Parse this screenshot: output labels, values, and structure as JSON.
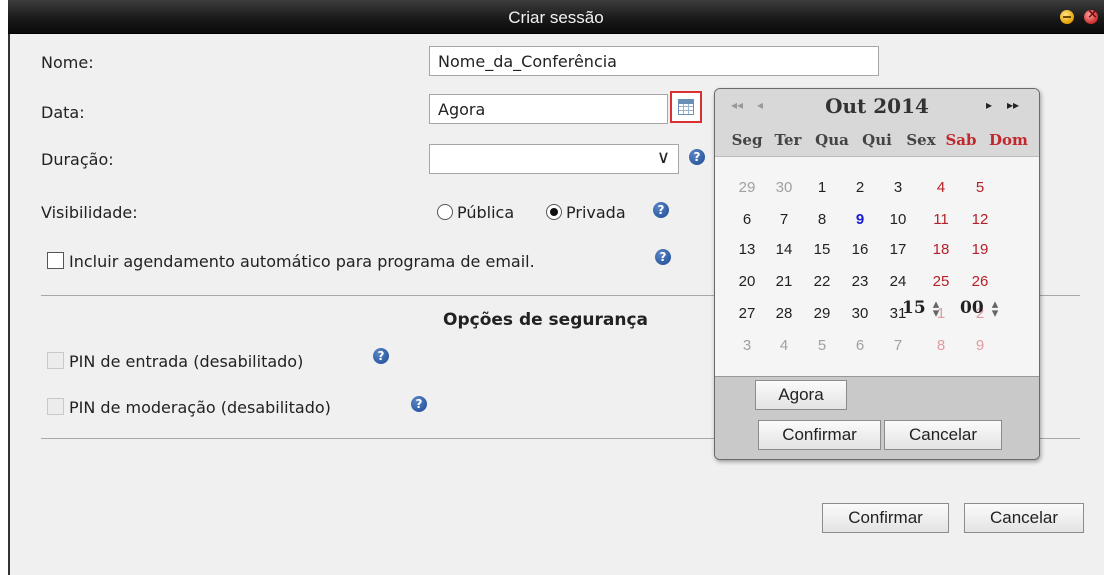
{
  "window": {
    "title": "Criar sessão"
  },
  "form": {
    "name_label": "Nome:",
    "name_value": "Nome_da_Conferência",
    "date_label": "Data:",
    "date_value": "Agora",
    "duration_label": "Duração:",
    "duration_value": "",
    "visibility_label": "Visibilidade:",
    "visibility_options": [
      "Pública",
      "Privada"
    ],
    "visibility_selected": "Privada",
    "auto_schedule_label": "Incluir agendamento automático para programa de email.",
    "security_title": "Opções de segurança",
    "pin_entry_label": "PIN de entrada (desabilitado)",
    "pin_moderation_label": "PIN de moderação (desabilitado)",
    "confirm_label": "Confirmar",
    "cancel_label": "Cancelar"
  },
  "calendar": {
    "month_label": "Out 2014",
    "nav_prev_year": "◂◂",
    "nav_prev_month": "◂",
    "nav_next_month": "▸",
    "nav_next_year": "▸▸",
    "weekdays": [
      "Seg",
      "Ter",
      "Qua",
      "Qui",
      "Sex",
      "Sab",
      "Dom"
    ],
    "weeks": [
      [
        "29",
        "30",
        "1",
        "2",
        "3",
        "4",
        "5"
      ],
      [
        "6",
        "7",
        "8",
        "9",
        "10",
        "11",
        "12"
      ],
      [
        "13",
        "14",
        "15",
        "16",
        "17",
        "18",
        "19"
      ],
      [
        "20",
        "21",
        "22",
        "23",
        "24",
        "25",
        "26"
      ],
      [
        "27",
        "28",
        "29",
        "30",
        "31",
        "1",
        "2"
      ],
      [
        "3",
        "4",
        "5",
        "6",
        "7",
        "8",
        "9"
      ]
    ],
    "today": "9",
    "now_label": "Agora",
    "hour": "15",
    "minute": "00",
    "confirm_label": "Confirmar",
    "cancel_label": "Cancelar"
  },
  "colors": {
    "titlebar": "#1a1a1a",
    "dialog_bg": "#f0f0f0",
    "weekend": "#b42028",
    "today": "#1a1ad0",
    "help_icon": "#1d4a91",
    "calendar_button_border": "#d93030"
  }
}
